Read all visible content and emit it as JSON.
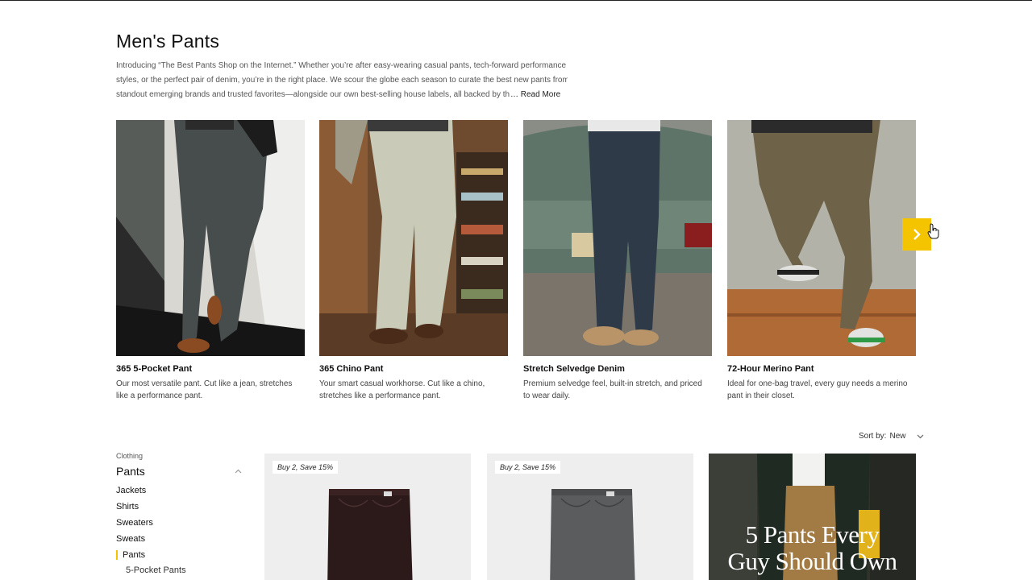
{
  "page": {
    "title": "Men's Pants",
    "intro_lines": [
      "Introducing “The Best Pants Shop on the Internet.” Whether you’re after easy-wearing casual pants, tech-forward performance",
      "styles, or the perfect pair of denim, you’re in the right place. We scour the globe each season to curate the best new pants from",
      "standout emerging brands and trusted favorites—alongside our own best-selling house labels, all backed by the HB Fi"
    ],
    "read_more": "… Read More"
  },
  "featured": [
    {
      "name": "365 5-Pocket Pant",
      "description": "Our most versatile pant. Cut like a jean, stretches like a performance pant."
    },
    {
      "name": "365 Chino Pant",
      "description": "Your smart casual workhorse. Cut like a chino, stretches like a performance pant."
    },
    {
      "name": "Stretch Selvedge Denim",
      "description": "Premium selvedge feel, built-in stretch, and priced to wear daily."
    },
    {
      "name": "72-Hour Merino Pant",
      "description": "Ideal for one-bag travel, every guy needs a merino pant in their closet."
    }
  ],
  "carousel": {
    "next_icon": "chevron-right-icon",
    "accent": "#f5c400"
  },
  "sort": {
    "label": "Sort by:",
    "value": "New"
  },
  "sidebar": {
    "crumb": "Clothing",
    "current": "Pants",
    "items": [
      "Jackets",
      "Shirts",
      "Sweaters",
      "Sweats"
    ],
    "active": "Pants",
    "sub_items": [
      "5-Pocket Pants"
    ]
  },
  "products": [
    {
      "badge": "Buy 2, Save 15%"
    },
    {
      "badge": "Buy 2, Save 15%"
    }
  ],
  "promo": {
    "title_line1": "5 Pants Every",
    "title_line2": "Guy Should Own"
  }
}
